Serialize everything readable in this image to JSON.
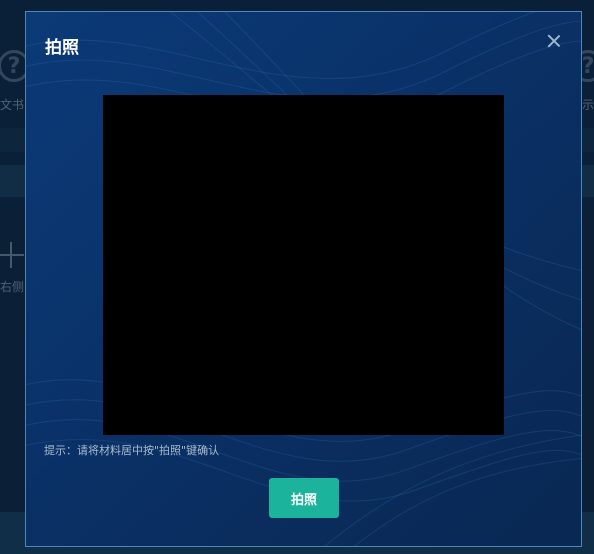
{
  "background": {
    "left_label": "文书",
    "right_label": "示",
    "add_label": "右侧",
    "help_icon": "question-circle-icon"
  },
  "dialog": {
    "title": "拍照",
    "close_icon": "close-icon",
    "hint": "提示：请将材料居中按\"拍照\"键确认",
    "capture_button": "拍照"
  },
  "colors": {
    "dialog_bg": "#0a2f63",
    "preview_bg": "#000000",
    "button_bg": "#1bb39c",
    "title_text": "#ffffff"
  }
}
